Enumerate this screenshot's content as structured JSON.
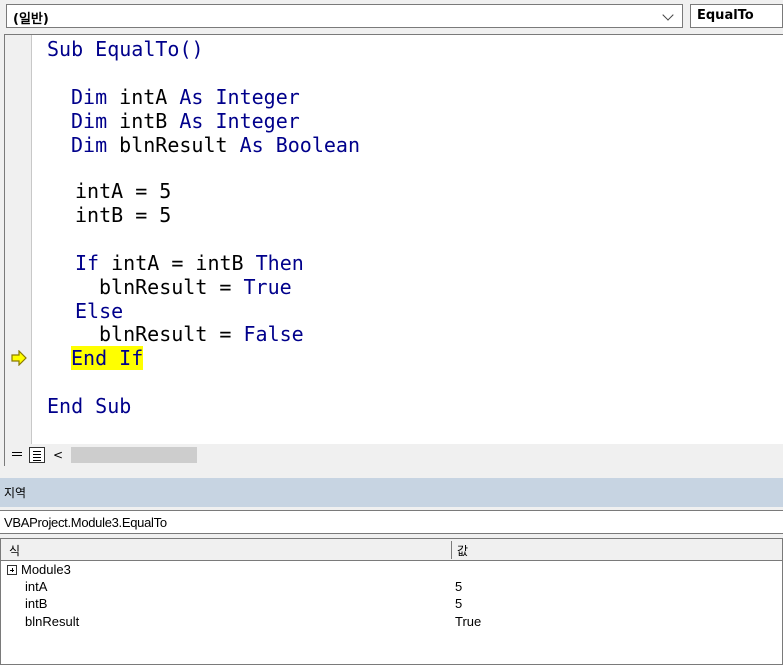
{
  "combos": {
    "object": "(일반)",
    "procedure": "EqualTo"
  },
  "code": {
    "l1": "Sub EqualTo()",
    "l2_dim": "Dim",
    "l2_var": " intA ",
    "l2_as": "As",
    "l2_type": " Integer",
    "l3_dim": "Dim",
    "l3_var": " intB ",
    "l3_as": "As",
    "l3_type": " Integer",
    "l4_dim": "Dim",
    "l4_var": " blnResult ",
    "l4_as": "As",
    "l4_type": " Boolean",
    "l5": "intA = 5",
    "l6": "intB = 5",
    "l7_if": "If",
    "l7_mid": " intA = intB ",
    "l7_then": "Then",
    "l8_var": "blnResult = ",
    "l8_val": "True",
    "l9": "Else",
    "l10_var": "blnResult = ",
    "l10_val": "False",
    "l11": "End If",
    "l12": "End Sub"
  },
  "scroll": {
    "left_arrow": "<"
  },
  "locals": {
    "title": "지역",
    "context": "VBAProject.Module3.EqualTo",
    "col_name": "식",
    "col_value": "값",
    "rows": [
      {
        "name": "Module3",
        "value": ""
      },
      {
        "name": "intA",
        "value": "5"
      },
      {
        "name": "intB",
        "value": "5"
      },
      {
        "name": "blnResult",
        "value": "True"
      }
    ]
  },
  "colors": {
    "keyword": "#00008b",
    "highlight": "#ffff00",
    "locals_title_bg": "#c7d4e2"
  }
}
